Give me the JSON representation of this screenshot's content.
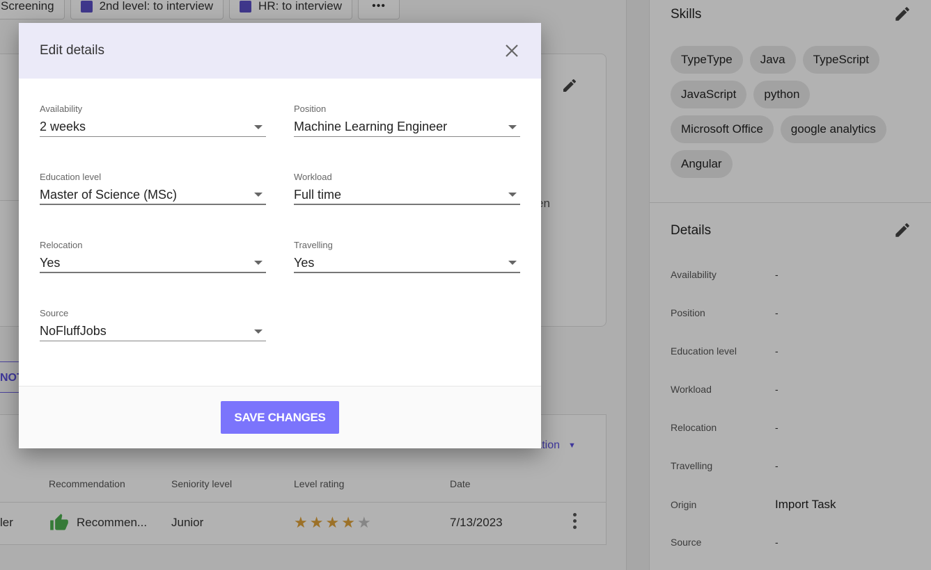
{
  "background": {
    "stage_chips": [
      {
        "label": "Screening",
        "has_color": false
      },
      {
        "label": "2nd level: to interview",
        "has_color": true
      },
      {
        "label": "HR: to interview",
        "has_color": true
      }
    ],
    "more_label": "•••",
    "partial_text": "en",
    "notes_tab_label": "NOTES",
    "add_evaluation_label": "Add new evaluation",
    "evaluations": {
      "headers": {
        "recommendation": "Recommendation",
        "seniority": "Seniority level",
        "rating": "Level rating",
        "date": "Date"
      },
      "rows": [
        {
          "evaluator_partial": "ler",
          "recommendation": "Recommen...",
          "seniority": "Junior",
          "rating": 4,
          "rating_max": 5,
          "date": "7/13/2023"
        }
      ]
    }
  },
  "right_panel": {
    "skills_title": "Skills",
    "skills": [
      "TypeType",
      "Java",
      "TypeScript",
      "JavaScript",
      "python",
      "Microsoft Office",
      "google analytics",
      "Angular"
    ],
    "details_title": "Details",
    "details": [
      {
        "label": "Availability",
        "value": "-"
      },
      {
        "label": "Position",
        "value": "-"
      },
      {
        "label": "Education level",
        "value": "-"
      },
      {
        "label": "Workload",
        "value": "-"
      },
      {
        "label": "Relocation",
        "value": "-"
      },
      {
        "label": "Travelling",
        "value": "-"
      },
      {
        "label": "Origin",
        "value": "Import Task"
      },
      {
        "label": "Source",
        "value": "-"
      }
    ]
  },
  "modal": {
    "title": "Edit details",
    "fields": {
      "availability": {
        "label": "Availability",
        "value": "2 weeks"
      },
      "position": {
        "label": "Position",
        "value": "Machine Learning Engineer"
      },
      "education_level": {
        "label": "Education level",
        "value": "Master of Science (MSc)"
      },
      "workload": {
        "label": "Workload",
        "value": "Full time"
      },
      "relocation": {
        "label": "Relocation",
        "value": "Yes"
      },
      "travelling": {
        "label": "Travelling",
        "value": "Yes"
      },
      "source": {
        "label": "Source",
        "value": "NoFluffJobs"
      }
    },
    "save_label": "SAVE CHANGES"
  },
  "colors": {
    "accent": "#7b74fc",
    "modal_header": "#ebeaf8",
    "stage_color": "#5b50c8",
    "star_on": "#e0a33a",
    "star_off": "#c0c0c0",
    "recommend_green": "#4caf50"
  }
}
